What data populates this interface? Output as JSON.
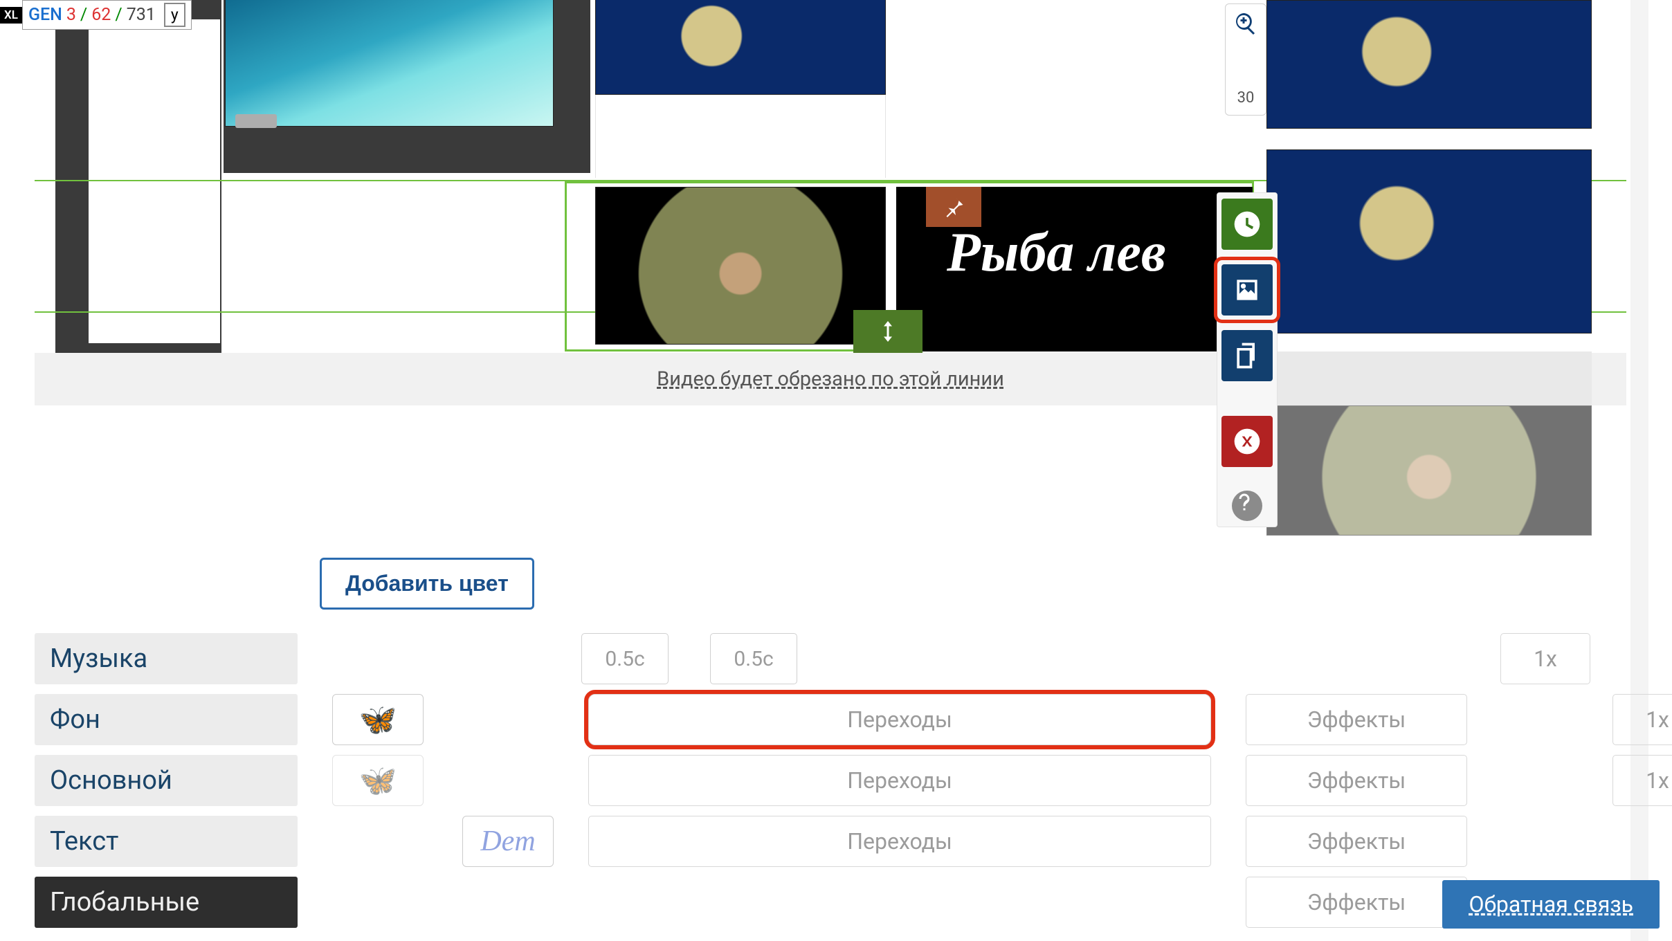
{
  "debug": {
    "size_label": "XL",
    "gen": "GEN",
    "n1": "3",
    "sep1": "/",
    "n2": "62",
    "sep2": "/",
    "n3": "731",
    "y": "y"
  },
  "zoom": {
    "value": "30"
  },
  "canvas": {
    "title_overlay": "Рыбa лев",
    "crop_notice": "Видео будет обрезано по этой линии"
  },
  "tools": {
    "clock": "clock-icon",
    "image": "image-icon",
    "copy": "copy-icon",
    "delete": "delete-icon",
    "help": "help-icon"
  },
  "add_color": "Добавить цвет",
  "time_inputs": {
    "a": "0.5c",
    "b": "0.5c"
  },
  "layers": {
    "music": "Музыка",
    "bg": "Фон",
    "main": "Основной",
    "text": "Текст",
    "global": "Глобальные"
  },
  "pills": {
    "transitions": "Переходы",
    "effects": "Эффекты",
    "speed": "1x"
  },
  "thumb_labels": {
    "demo": "Dem"
  },
  "feedback": "Обратная связь"
}
